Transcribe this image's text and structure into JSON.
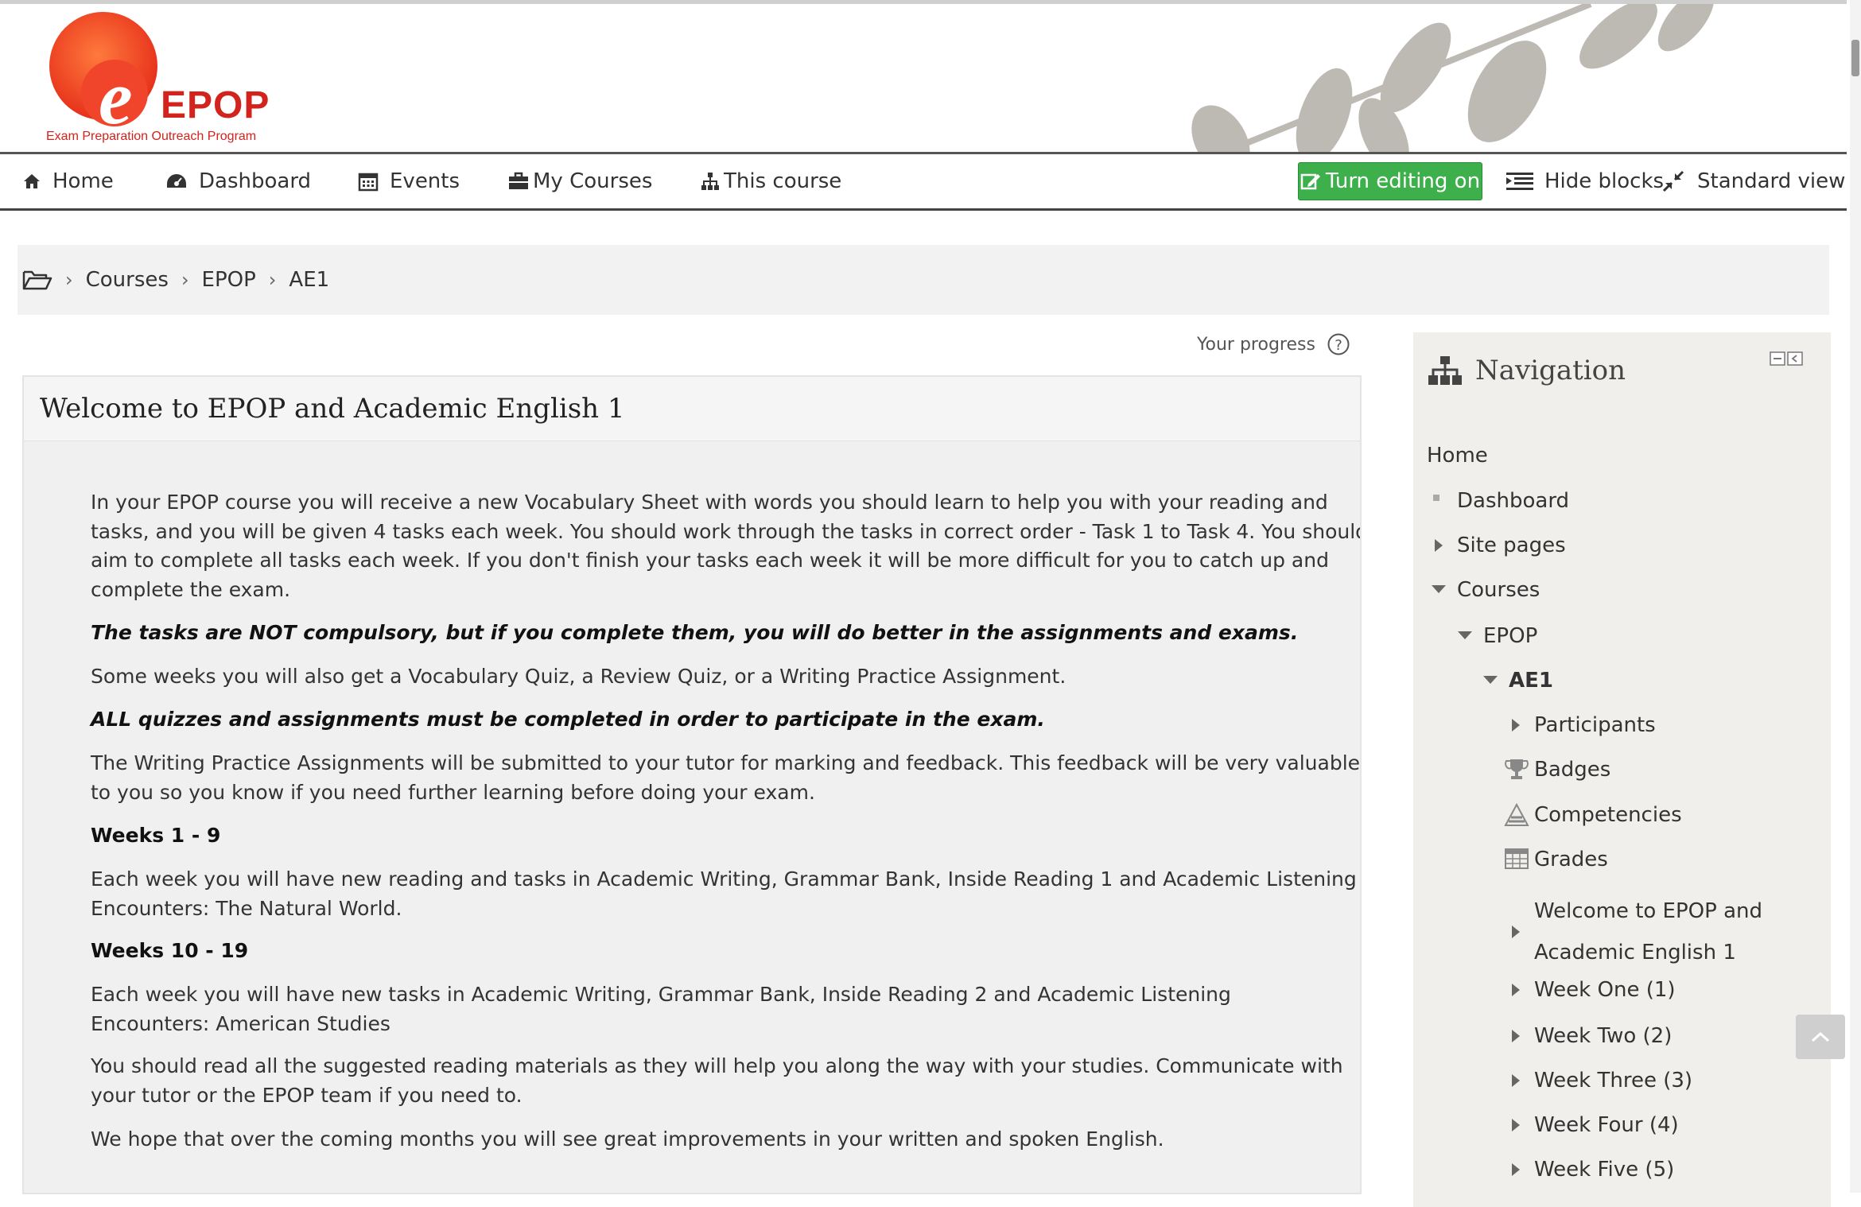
{
  "brand": {
    "logo_letter": "e",
    "logo_title": "EPOP",
    "logo_subtitle": "Exam Preparation Outreach Program",
    "accent": "#d2231c"
  },
  "navbar": {
    "items": [
      {
        "label": "Home",
        "icon": "home-icon"
      },
      {
        "label": "Dashboard",
        "icon": "dashboard-icon"
      },
      {
        "label": "Events",
        "icon": "calendar-icon"
      },
      {
        "label": "My Courses",
        "icon": "briefcase-icon"
      },
      {
        "label": "This course",
        "icon": "sitemap-icon"
      }
    ],
    "edit_button": "Turn editing on",
    "hide_blocks": "Hide blocks",
    "standard_view": "Standard view",
    "edit_color": "#3db04b"
  },
  "breadcrumb": {
    "items": [
      "Courses",
      "EPOP",
      "AE1"
    ]
  },
  "progress": {
    "label": "Your progress"
  },
  "main": {
    "title": "Welcome to EPOP and Academic English 1",
    "p1": "In your EPOP course you will receive a new Vocabulary Sheet with words you should learn to help you with your reading and tasks, and you will be given 4 tasks each week. You should work through the tasks in correct order - Task 1 to Task 4. You should aim to complete all tasks each week. If you don't finish your tasks each week it will be more difficult for you to catch up and complete the exam.",
    "p2": "The tasks are NOT compulsory, but if you complete them, you will do better in the assignments and exams.",
    "p3": "Some weeks you will also get a Vocabulary Quiz, a Review Quiz, or a Writing Practice Assignment.",
    "p4": "ALL quizzes and assignments must be completed in order to participate in the exam.",
    "p5": "The Writing Practice Assignments will be submitted to your tutor for marking and feedback. This feedback will be very valuable to you so you know if you need further learning before doing your exam.",
    "h1": "Weeks 1 - 9",
    "p6": "Each week you will have new reading and tasks in Academic Writing, Grammar Bank, Inside Reading 1 and Academic Listening Encounters: The Natural World.",
    "h2": "Weeks 10 - 19",
    "p7": "Each week you will have new tasks in Academic Writing, Grammar Bank, Inside Reading 2 and Academic Listening Encounters: American Studies",
    "p8": "You should read all the suggested reading materials as they will help you along the way with your studies. Communicate with your tutor or the EPOP team if you need to.",
    "p9": "We hope that over the coming months you will see great improvements in your written and spoken English."
  },
  "navigation": {
    "title": "Navigation",
    "home": "Home",
    "dashboard": "Dashboard",
    "site_pages": "Site pages",
    "courses": "Courses",
    "epop": "EPOP",
    "ae1": "AE1",
    "participants": "Participants",
    "badges": "Badges",
    "competencies": "Competencies",
    "grades": "Grades",
    "welcome_line1": "Welcome to EPOP and",
    "welcome_line2": "Academic English 1",
    "weeks": [
      "Week One (1)",
      "Week Two (2)",
      "Week Three (3)",
      "Week Four (4)",
      "Week Five (5)"
    ]
  }
}
